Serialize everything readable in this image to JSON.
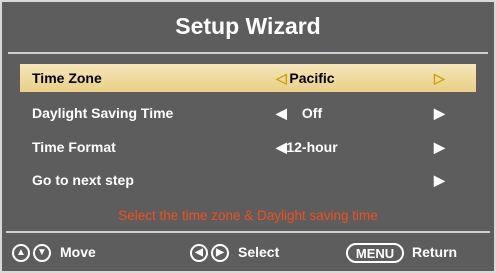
{
  "title": "Setup Wizard",
  "rows": [
    {
      "label": "Time Zone",
      "value": "Pacific",
      "left_arrow": "◁",
      "right_arrow": "▷"
    },
    {
      "label": "Daylight Saving Time",
      "value": "Off",
      "left_arrow": "◀",
      "right_arrow": "▶"
    },
    {
      "label": "Time Format",
      "value": "12-hour",
      "left_arrow": "◀",
      "right_arrow": "▶"
    },
    {
      "label": "Go to next step",
      "value": "",
      "left_arrow": "",
      "right_arrow": "▶"
    }
  ],
  "hint": "Select the time zone & Daylight saving time",
  "footer": {
    "up_icon": "▲",
    "down_icon": "▼",
    "move_label": "Move",
    "left_icon": "◀",
    "right_icon": "▶",
    "select_label": "Select",
    "menu_key": "MENU",
    "return_label": "Return"
  },
  "colors": {
    "background": "#5d5d5d",
    "selected_row": "#f1dfa7",
    "hint_text": "#f04e1c"
  }
}
